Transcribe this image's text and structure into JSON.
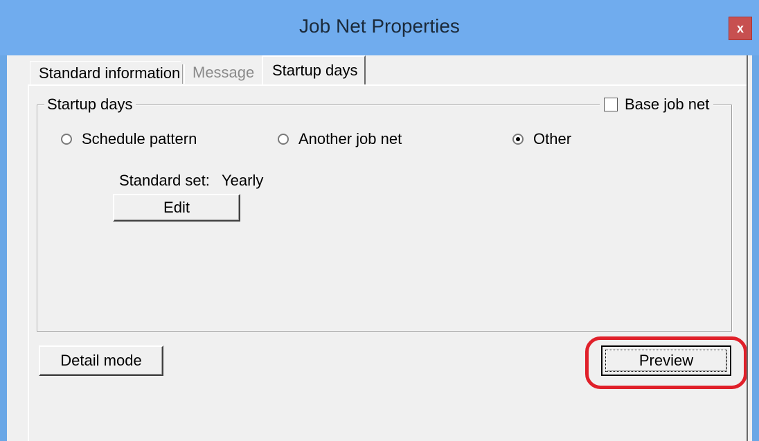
{
  "window": {
    "title": "Job Net Properties",
    "close_label": "x"
  },
  "tabs": [
    {
      "label": "Standard information"
    },
    {
      "label": "Message"
    },
    {
      "label": "Startup days"
    }
  ],
  "startup_group": {
    "legend": "Startup days",
    "base_job_net_label": "Base job net",
    "base_job_net_checked": false,
    "options": [
      {
        "label": "Schedule pattern",
        "selected": false
      },
      {
        "label": "Another job net",
        "selected": false
      },
      {
        "label": "Other",
        "selected": true
      }
    ],
    "standard_set_label": "Standard set:",
    "standard_set_value": "Yearly",
    "edit_label": "Edit"
  },
  "buttons": {
    "detail_mode_label": "Detail mode",
    "preview_label": "Preview"
  },
  "colors": {
    "title_bar": "#70acee",
    "close_button": "#c75050",
    "highlight_ring": "#e0202a",
    "dialog_bg": "#f0f0f0"
  }
}
